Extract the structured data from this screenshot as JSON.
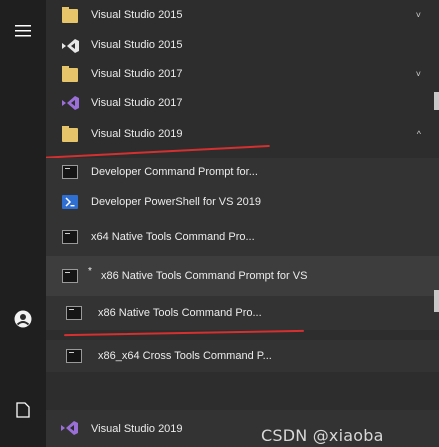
{
  "rail": {
    "hamburger_icon": "hamburger-icon",
    "user_icon": "user-icon",
    "document_icon": "document-icon"
  },
  "entries": [
    {
      "kind": "group",
      "label": "Visual Studio 2015",
      "icon": "folder-icon",
      "chevron": "˅"
    },
    {
      "kind": "group",
      "label": "Visual Studio 2015",
      "icon": "visual-studio-icon",
      "chevron": ""
    },
    {
      "kind": "group",
      "label": "Visual Studio 2017",
      "icon": "folder-icon",
      "chevron": "˅"
    },
    {
      "kind": "group",
      "label": "Visual Studio 2017",
      "icon": "visual-studio-icon",
      "chevron": ""
    },
    {
      "kind": "group",
      "label": "Visual Studio 2019",
      "icon": "folder-icon",
      "chevron": "^"
    },
    {
      "kind": "item",
      "label": "Developer Command Prompt for...",
      "icon": "command-prompt-icon"
    },
    {
      "kind": "item",
      "label": "Developer PowerShell for VS 2019",
      "icon": "powershell-icon"
    },
    {
      "kind": "item",
      "label": "x64 Native Tools Command Pro...",
      "icon": "command-prompt-icon"
    },
    {
      "kind": "item",
      "label": "x86 Native Tools Command Prompt for VS",
      "icon": "command-prompt-icon"
    },
    {
      "kind": "item",
      "label": "x86 Native Tools Command Pro...",
      "icon": "command-prompt-icon"
    },
    {
      "kind": "item",
      "label": "x86_x64 Cross Tools Command P...",
      "icon": "command-prompt-icon"
    },
    {
      "kind": "item",
      "label": "Visual Studio 2019",
      "icon": "visual-studio-icon"
    }
  ],
  "watermark": "CSDN @xiaoba",
  "colors": {
    "folder": "#e6c46a",
    "vs_purple": "#9b6fd8",
    "powershell_blue": "#2f6fd1",
    "annotation_red": "#d43030"
  }
}
